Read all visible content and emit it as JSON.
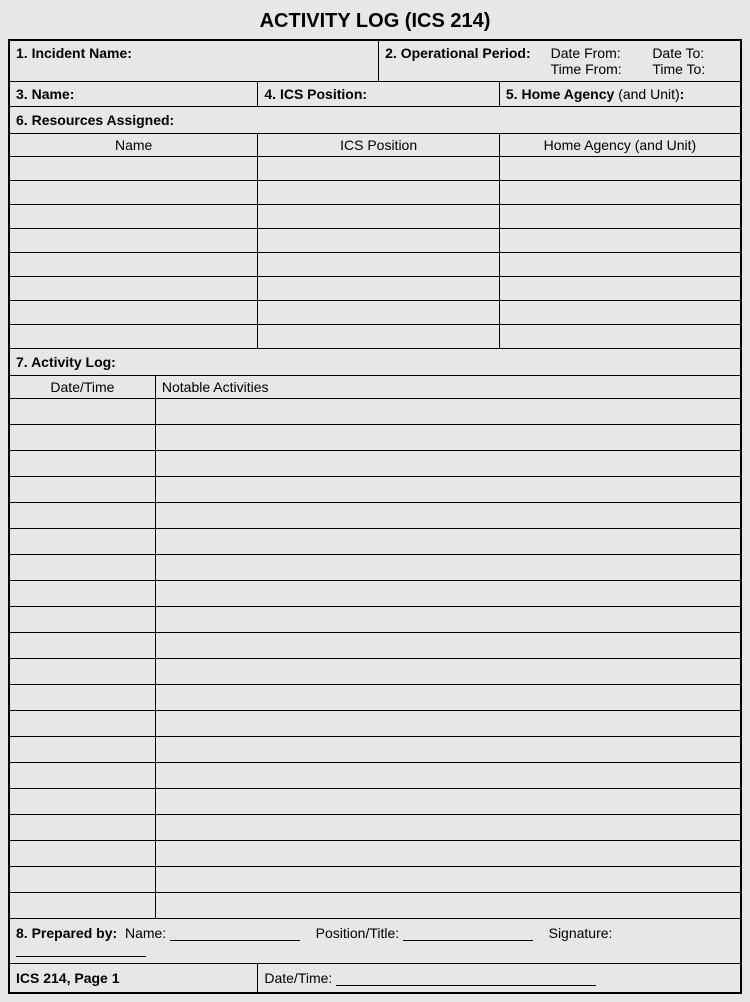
{
  "title": "ACTIVITY LOG (ICS 214)",
  "box1": {
    "num": "1.",
    "label": "Incident Name:"
  },
  "box2": {
    "num": "2.",
    "label": "Operational Period:",
    "dateFrom": "Date From:",
    "dateTo": "Date To:",
    "timeFrom": "Time From:",
    "timeTo": "Time To:"
  },
  "box3": {
    "num": "3.",
    "label": "Name:"
  },
  "box4": {
    "num": "4.",
    "label": "ICS Position:"
  },
  "box5": {
    "num": "5.",
    "label_a": "Home Agency",
    "label_b": " (and Unit)",
    "colon": ":"
  },
  "box6": {
    "num": "6.",
    "label": "Resources Assigned:",
    "col1": "Name",
    "col2": "ICS Position",
    "col3": "Home Agency (and Unit)"
  },
  "box7": {
    "num": "7.",
    "label": "Activity Log:",
    "col1": "Date/Time",
    "col2": "Notable Activities"
  },
  "box8": {
    "num": "8.",
    "label": "Prepared by:",
    "name": "Name:",
    "position": "Position/Title:",
    "signature": "Signature:"
  },
  "footer": {
    "formId": "ICS 214, Page 1",
    "dateTime": "Date/Time:"
  }
}
